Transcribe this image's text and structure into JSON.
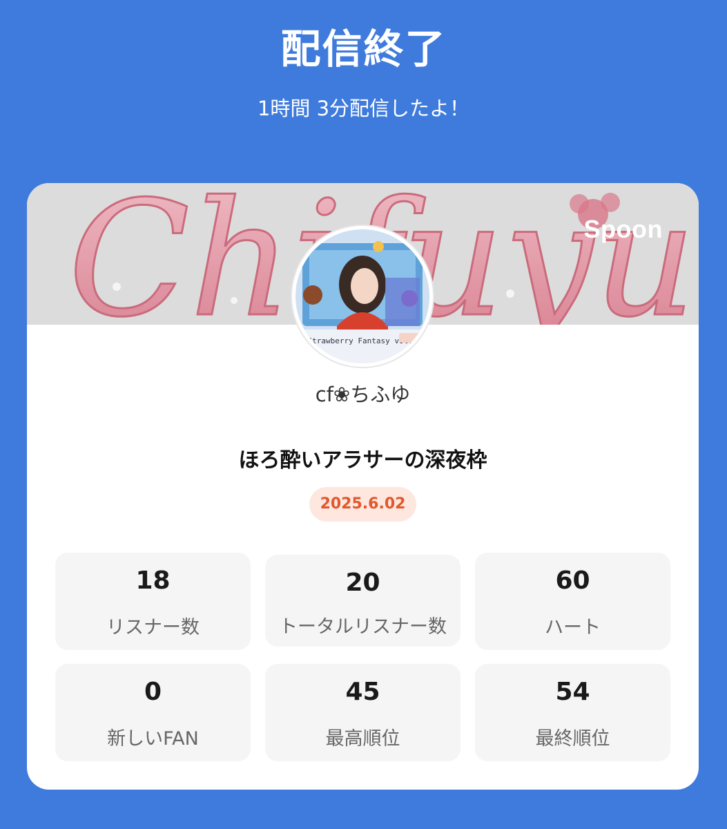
{
  "header": {
    "title": "配信終了",
    "subtitle": "1時間 3分配信したよ！"
  },
  "card": {
    "brand": "Spoon",
    "banner_text": "Chifuyu",
    "username": "cf❀ちふゆ",
    "show_title": "ほろ酔いアラサーの深夜枠",
    "date": "2025.6.02",
    "stats": [
      {
        "value": "18",
        "label": "リスナー数"
      },
      {
        "value": "20",
        "label": "トータルリスナー数"
      },
      {
        "value": "60",
        "label": "ハート"
      },
      {
        "value": "0",
        "label": "新しいFAN"
      },
      {
        "value": "45",
        "label": "最高順位"
      },
      {
        "value": "54",
        "label": "最終順位"
      }
    ]
  },
  "colors": {
    "background": "#3f7bdc",
    "date_badge_bg": "#fde7df",
    "date_badge_text": "#e2572c",
    "stat_bg": "#f5f5f5"
  },
  "icons": {
    "avatar": "profile-illustration"
  }
}
